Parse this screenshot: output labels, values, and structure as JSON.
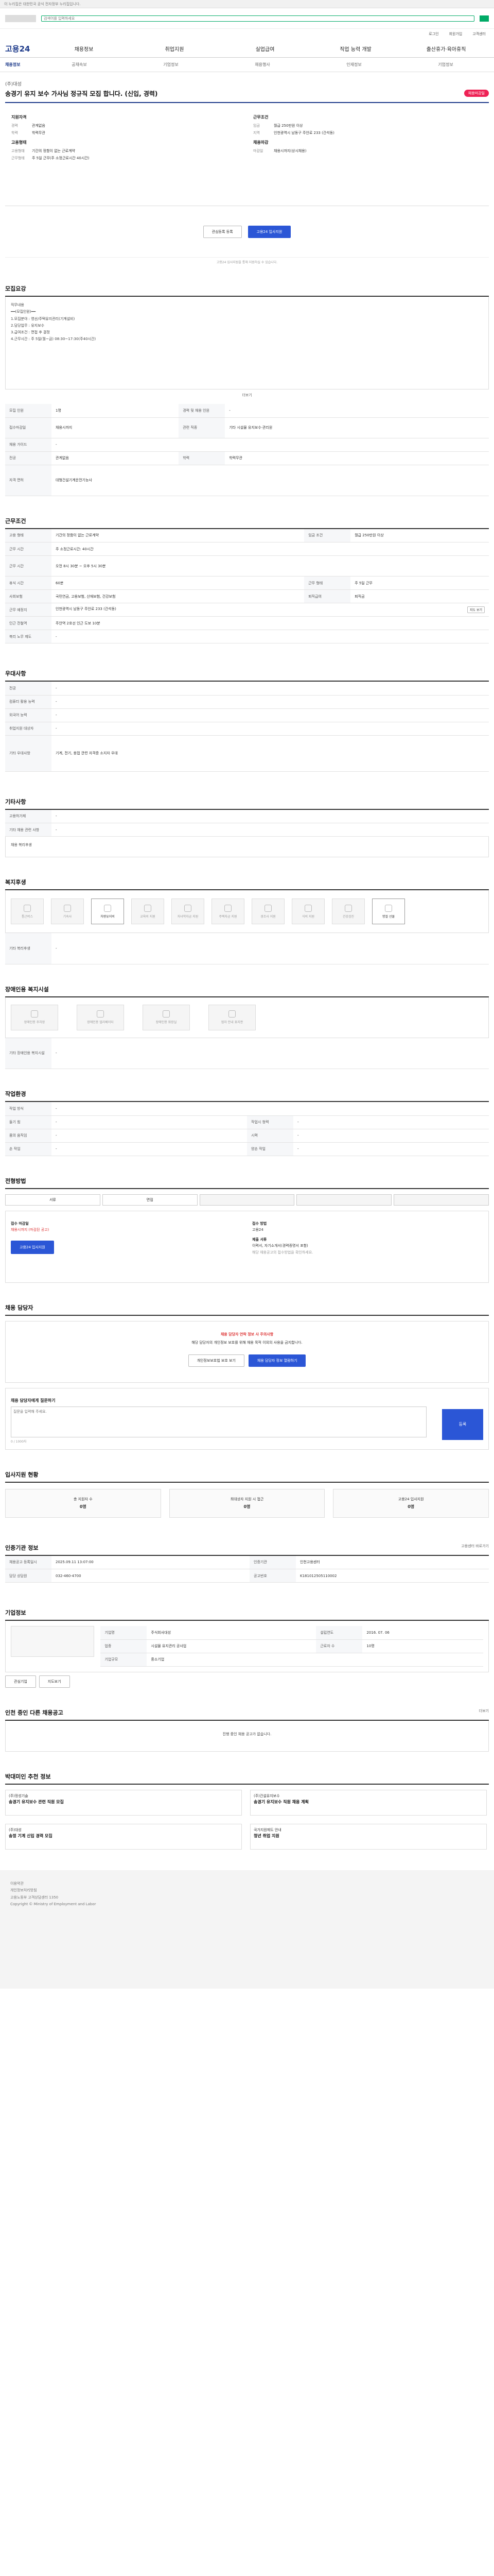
{
  "banner": "이 누리집은 대한민국 공식 전자정부 누리집입니다.",
  "gov": {
    "search_placeholder": "검색어를 입력하세요"
  },
  "topmenu": [
    "로그인",
    "회원가입",
    "고객센터"
  ],
  "brand": "고용24",
  "nav": [
    "채용정보",
    "취업지원",
    "실업급여",
    "직업 능력 개발",
    "출산휴가·육아휴직"
  ],
  "subnav": [
    "채용정보",
    "공채속보",
    "기업정보",
    "채용행사",
    "인재정보",
    "기업정보"
  ],
  "job": {
    "company": "(주)대성",
    "title": "송경기 유지 보수 가사님 정규직 모집 합니다. (신입, 경력)",
    "badge": "채용마감일"
  },
  "summary": {
    "left_head": "지원자격",
    "left": [
      [
        "경력",
        "관계없음"
      ],
      [
        "학력",
        "학력무관"
      ]
    ],
    "left_head2": "고용형태",
    "left2": [
      [
        "고용형태",
        "기간의 정함이 없는 근로계약"
      ],
      [
        "근무형태",
        "주 5일 근무(주 소정근로시간 40시간)"
      ]
    ],
    "right_head": "근무조건",
    "right": [
      [
        "임금",
        "월급 250만원 이상"
      ],
      [
        "지역",
        "인천광역시 남동구 주안로 233 (간석동)"
      ]
    ],
    "right_head2": "채용마감",
    "right2": [
      [
        "마감일",
        "채용시까지(상시채용)"
      ]
    ]
  },
  "actions": {
    "save": "관심등록 등록",
    "apply": "고용24 입사지원"
  },
  "notice": "고용24 입사지원을 통해 지원하실 수 있습니다.",
  "recruit": {
    "title": "모집요강",
    "lines": [
      "직무내용",
      "━━(모집인원)━━",
      "1.모집분야 : 영선/주택유지관리(기계설비)",
      "2.담당업무 : 유지보수",
      "3.급여조건 : 면접 후 결정",
      "4.근무시간 : 주 5일(월~금) 08:30~17:30(주40시간)"
    ],
    "more": "더보기"
  },
  "rtable": [
    [
      "모집 인원",
      "1명",
      "경력 및 채용 인원",
      "-"
    ],
    [
      "접수마감일",
      "채용시까지",
      "관련 직종",
      "기타 시설물 유지보수·관리원"
    ],
    [
      "채용 가이드",
      "-",
      "",
      ""
    ],
    [
      "전공",
      "관계없음",
      "학력",
      "학력무관"
    ],
    [
      "자격 면허",
      "대형건설기계운전기능사",
      "",
      ""
    ]
  ],
  "conditions": {
    "title": "근무조건",
    "rows": [
      [
        "고용 형태",
        "기간의 정함이 없는 근로계약",
        "임금 조건",
        "월급 250만원 이상"
      ],
      [
        "근무 시간",
        "주 소정근로시간: 40시간",
        "",
        ""
      ],
      [
        "근무 시간",
        "오전 8시 30분 ~ 오후 5시 30분",
        "",
        ""
      ],
      [
        "휴식 시간",
        "60분",
        "근무 형태",
        "주 5일 근무"
      ],
      [
        "사회보험",
        "국민연금, 고용보험, 산재보험, 건강보험",
        "퇴직급여",
        "퇴직금"
      ],
      [
        "근무 예정지",
        "인천광역시 남동구 주안로 233 (간석동)",
        "",
        ""
      ],
      [
        "인근 전철역",
        "주안역 2호선 인근 도보 10분",
        "",
        ""
      ],
      [
        "복리 노무 제도",
        "-",
        "",
        ""
      ]
    ],
    "map_btn": "지도 보기"
  },
  "welfare": {
    "title": "우대사항",
    "rows": [
      [
        "전공",
        "-"
      ],
      [
        "컴퓨터 활용 능력",
        "-"
      ],
      [
        "외국어 능력",
        "-"
      ],
      [
        "취업지원 대상자",
        "-"
      ],
      [
        "기타 우대사항",
        "기계, 전기, 용접 관련 자격증 소지자 우대"
      ]
    ]
  },
  "other": {
    "title": "기타사항",
    "rows": [
      [
        "고용허가제",
        "-"
      ],
      [
        "기타 채용 관련 사항",
        "-"
      ]
    ],
    "more": "채용 복리후생"
  },
  "benefits": {
    "title": "복지후생",
    "items": [
      "통근버스",
      "기숙사",
      "차량유지비",
      "교육비 지원",
      "자녀학자금 지원",
      "주택자금 지원",
      "경조사 지원",
      "식비 지원",
      "건강검진",
      "명절 선물"
    ],
    "note": "기타 복리후생",
    "note_v": "-"
  },
  "disability": {
    "title": "장애인용 복지시설",
    "items": [
      "장애인용 주차장",
      "장애인용 엘리베이터",
      "장애인용 화장실",
      "점자 안내 표지판"
    ],
    "note": "기타 장애인용 복지시설",
    "note_v": "-"
  },
  "worker": {
    "title": "작업환경",
    "rows": [
      [
        "작업 방식",
        "-",
        "",
        ""
      ],
      [
        "들기 힘",
        "-",
        "작업시 청력",
        "-"
      ],
      [
        "몸의 움직임",
        "-",
        "시력",
        "-"
      ],
      [
        "손 작업",
        "-",
        "양손 작업",
        "-"
      ]
    ]
  },
  "process": {
    "title": "전형방법",
    "tabs": [
      "서류",
      "면접",
      "",
      "",
      ""
    ]
  },
  "applyinfo": {
    "head1": "접수 마감일",
    "v1": "채용시까지 (마감된 공고)",
    "head2": "접수 방법",
    "v2": "고용24",
    "apply_btn": "고용24 입사지원",
    "head3": "제출 서류",
    "v3": "이력서, 자기소개서(경력증명서 포함)",
    "desc": "해당 채용공고의 접수방법을 확인하세요."
  },
  "contact": {
    "title": "채용 담당자",
    "warn": "채용 담당자 연락 정보 사 주의사항",
    "desc": "해당 담당자의 개인정보 보호를 위해 채용 목적 이외의 사용을 금지합니다.",
    "btn1": "개인정보보호법 보호 보기",
    "btn2": "채용 담당자 정보 열람하기"
  },
  "qa": {
    "title": "채용 담당자에게 질문하기",
    "placeholder": "질문을 입력해 주세요.",
    "send": "등록",
    "counter": "0 / 1000자"
  },
  "stats": {
    "title": "입사지원 현황",
    "items": [
      [
        "총 지원자 수",
        "0명"
      ],
      [
        "최대상자 지원 시 접근",
        "0명"
      ],
      [
        "고용24 입사지원",
        "0명"
      ]
    ]
  },
  "reg": {
    "title": "인증기관 정보",
    "rows": [
      [
        "채용공고 등록일시",
        "2025.09.11 13:07:00",
        "인증기관",
        "인천고용센터"
      ],
      [
        "담당 상담원",
        "032-460-4700",
        "공고번호",
        "K181012505110002"
      ]
    ],
    "btn": "고용센터 바로가기"
  },
  "company": {
    "title": "기업정보",
    "rows": [
      [
        "기업명",
        "주식회사대성",
        "설립연도",
        "2016. 07. 06"
      ],
      [
        "업종",
        "시설물 유지관리 공사업",
        "근로자 수",
        "10명"
      ],
      [
        "기업규모",
        "중소기업",
        "",
        ""
      ]
    ],
    "btns": [
      "관심기업",
      "지도보기"
    ]
  },
  "nearby": {
    "title": "인천 중인 다른 채용공고",
    "more": "더보기",
    "empty": "진행 중인 채용 공고가 없습니다."
  },
  "recommend": {
    "title": "박대미인 추천 정보",
    "items": [
      [
        "(주)정성기술",
        "송경기 유지보수 관련 직원 모집"
      ],
      [
        "(주)건설유지보수",
        "송경기 유지보수 직원 채용 계획"
      ],
      [
        "(주)대성",
        "송정 기계 신입 경력 모집"
      ],
      [
        "국가지원제도 안내",
        "청년 취업 지원"
      ]
    ]
  },
  "footer": [
    "이용약관",
    "개인정보처리방침",
    "고용노동부 고객상담센터 1350",
    "Copyright © Ministry of Employment and Labor"
  ]
}
